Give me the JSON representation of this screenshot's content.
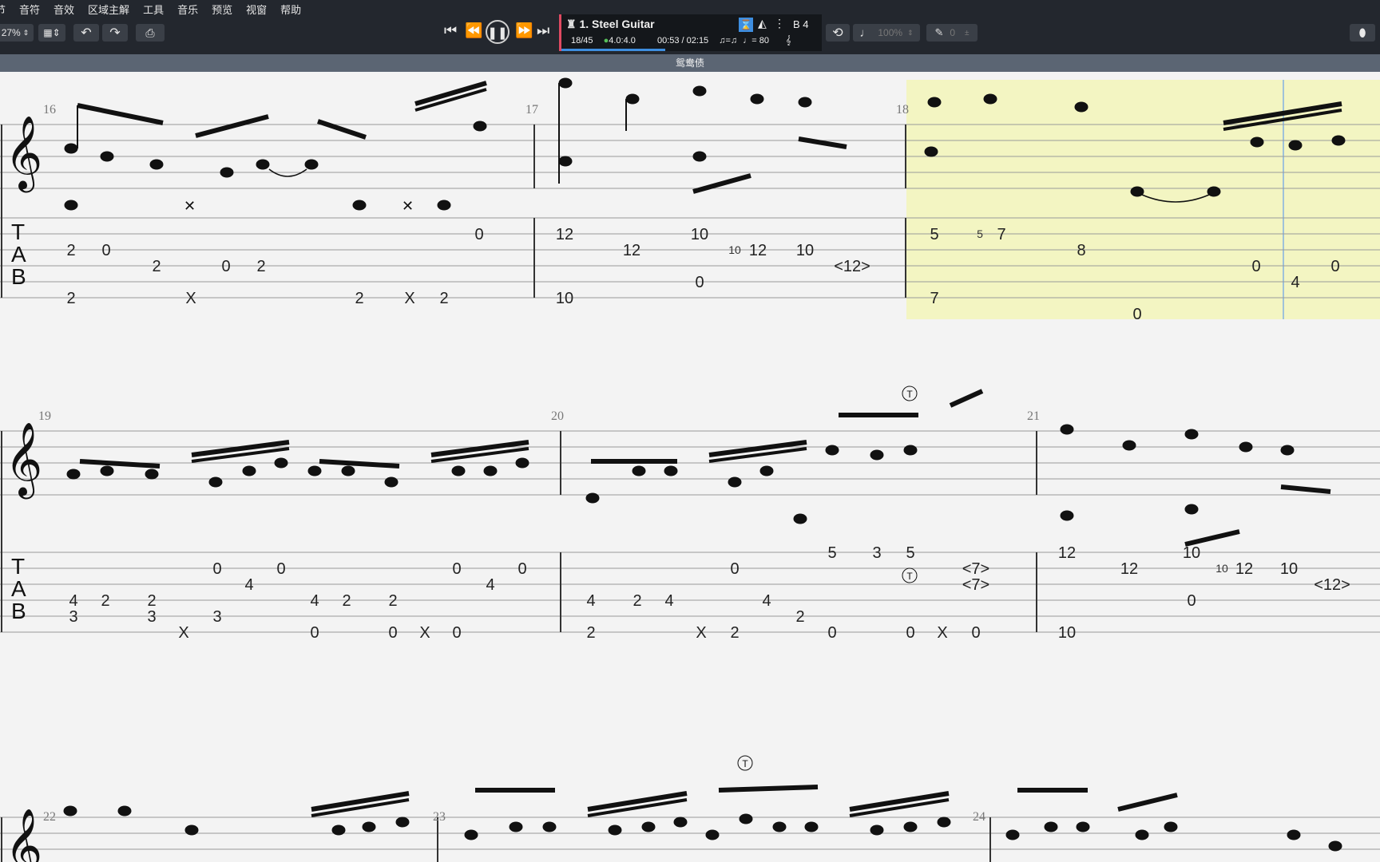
{
  "menu": [
    "节",
    "音符",
    "音效",
    "区域主解",
    "工具",
    "音乐",
    "预览",
    "视窗",
    "帮助"
  ],
  "toolbar": {
    "zoom": "27%",
    "icons": [
      "layout-icon",
      "undo-icon",
      "redo-icon",
      "print-icon"
    ]
  },
  "transport": {
    "buttons": [
      "first-icon",
      "rewind-icon",
      "pause-icon",
      "forward-icon",
      "last-icon"
    ]
  },
  "lcd": {
    "track": "1. Steel Guitar",
    "bar": "18/45",
    "signature": "4.0:4.0",
    "time": "00:53 / 02:15",
    "triplet": "♫=♫",
    "tempo": "♩= 80",
    "key": "B 4",
    "progress": 0.4
  },
  "playback": {
    "speed": "100%",
    "count": "0"
  },
  "title": "鸳鸯债",
  "score": {
    "systems": [
      {
        "bars": [
          {
            "num": "16",
            "frets": [
              [
                "2",
                "0",
                "2",
                "0",
                "2"
              ],
              [
                "2",
                "X",
                "2",
                "X",
                "2",
                "0"
              ]
            ]
          },
          {
            "num": "17",
            "frets": [
              [
                "12",
                "12",
                "10",
                "10",
                "12",
                "10",
                "<12>",
                "0",
                "10"
              ]
            ]
          },
          {
            "num": "18",
            "frets": [
              [
                "5",
                "5",
                "7",
                "8",
                "0",
                "4",
                "0",
                "7",
                "0"
              ]
            ]
          }
        ]
      },
      {
        "bars": [
          {
            "num": "19",
            "frets": [
              [
                "4",
                "2",
                "2",
                "0",
                "4",
                "0",
                "4",
                "2",
                "2",
                "0",
                "4",
                "0",
                "3",
                "3",
                "3",
                "X",
                "0",
                "0",
                "X",
                "0"
              ]
            ]
          },
          {
            "num": "20",
            "frets": [
              [
                "4",
                "2",
                "4",
                "0",
                "4",
                "2",
                "5",
                "3",
                "5",
                "<7>",
                "<7>",
                "2",
                "X",
                "2",
                "0",
                "0",
                "X",
                "0"
              ]
            ]
          },
          {
            "num": "21",
            "frets": [
              [
                "12",
                "12",
                "10",
                "10",
                "12",
                "10",
                "<12>",
                "0",
                "10"
              ]
            ]
          }
        ]
      },
      {
        "bars": [
          {
            "num": "22"
          },
          {
            "num": "23"
          },
          {
            "num": "24"
          }
        ]
      }
    ],
    "tab_clef": [
      "T",
      "A",
      "B"
    ],
    "technique": "T"
  }
}
